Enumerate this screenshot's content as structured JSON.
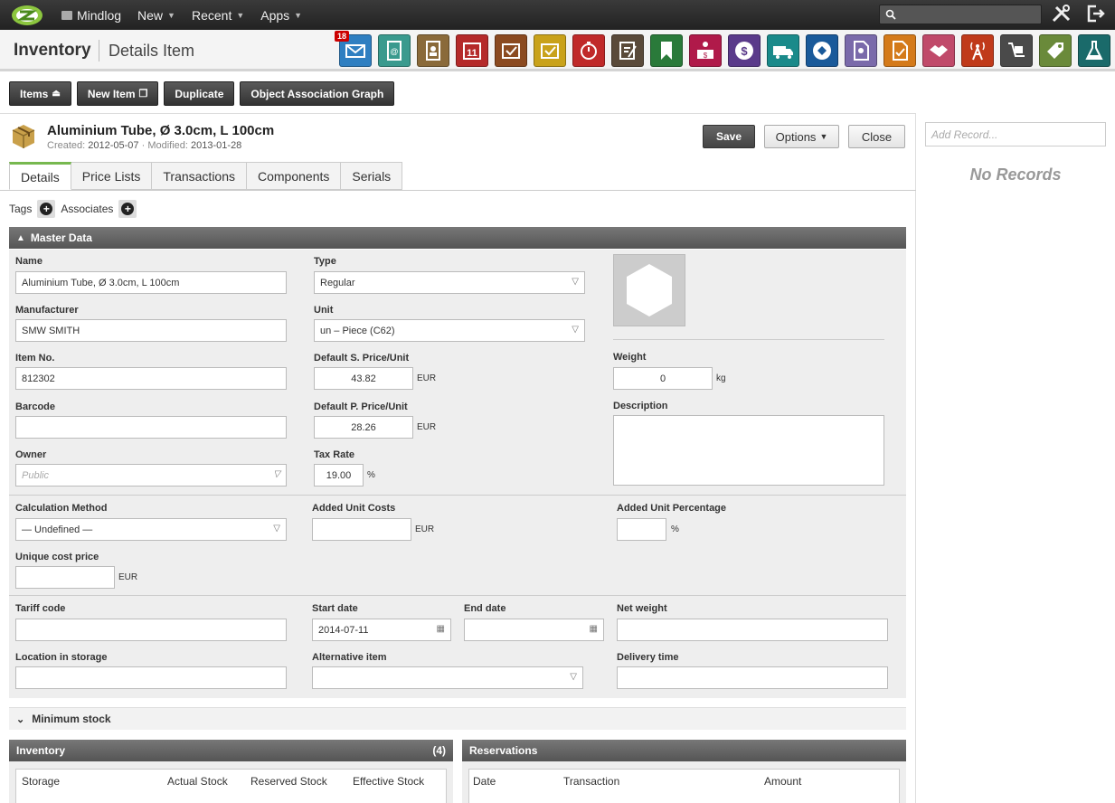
{
  "topbar": {
    "brand": "Mindlog",
    "menu": [
      {
        "label": "New"
      },
      {
        "label": "Recent"
      },
      {
        "label": "Apps"
      }
    ]
  },
  "header": {
    "module": "Inventory",
    "page": "Details Item",
    "mail_badge": "18"
  },
  "toolbar": {
    "items": "Items",
    "new_item": "New Item",
    "duplicate": "Duplicate",
    "graph": "Object Association Graph"
  },
  "item": {
    "title": "Aluminium Tube, Ø 3.0cm, L 100cm",
    "created_label": "Created:",
    "created": "2012-05-07",
    "modified_label": "Modified:",
    "modified": "2013-01-28"
  },
  "actions": {
    "save": "Save",
    "options": "Options",
    "close": "Close"
  },
  "tabs": [
    "Details",
    "Price Lists",
    "Transactions",
    "Components",
    "Serials"
  ],
  "tags": {
    "tags_label": "Tags",
    "associates_label": "Associates"
  },
  "master": {
    "title": "Master Data",
    "name_label": "Name",
    "name": "Aluminium Tube, Ø 3.0cm, L 100cm",
    "type_label": "Type",
    "type": "Regular",
    "manufacturer_label": "Manufacturer",
    "manufacturer": "SMW SMITH",
    "unit_label": "Unit",
    "unit": "un – Piece (C62)",
    "itemno_label": "Item No.",
    "itemno": "812302",
    "sprice_label": "Default S. Price/Unit",
    "sprice": "43.82",
    "weight_label": "Weight",
    "weight": "0",
    "weight_unit": "kg",
    "barcode_label": "Barcode",
    "pprice_label": "Default P. Price/Unit",
    "pprice": "28.26",
    "description_label": "Description",
    "owner_label": "Owner",
    "owner_placeholder": "Public",
    "tax_label": "Tax Rate",
    "tax": "19.00",
    "percent": "%",
    "currency": "EUR",
    "calc_label": "Calculation Method",
    "calc": "— Undefined —",
    "added_costs_label": "Added Unit Costs",
    "added_pct_label": "Added Unit Percentage",
    "unique_label": "Unique cost price",
    "tariff_label": "Tariff code",
    "start_label": "Start date",
    "start": "2014-07-11",
    "end_label": "End date",
    "net_label": "Net weight",
    "location_label": "Location in storage",
    "alt_label": "Alternative item",
    "delivery_label": "Delivery time"
  },
  "minimum_stock": "Minimum stock",
  "inventory_panel": {
    "title": "Inventory",
    "count": "(4)",
    "columns": [
      "Storage",
      "Actual Stock",
      "Reserved Stock",
      "Effective Stock"
    ]
  },
  "reservations_panel": {
    "title": "Reservations",
    "columns": [
      "Date",
      "Transaction",
      "Amount"
    ]
  },
  "right": {
    "add_placeholder": "Add Record...",
    "no_records": "No Records"
  }
}
